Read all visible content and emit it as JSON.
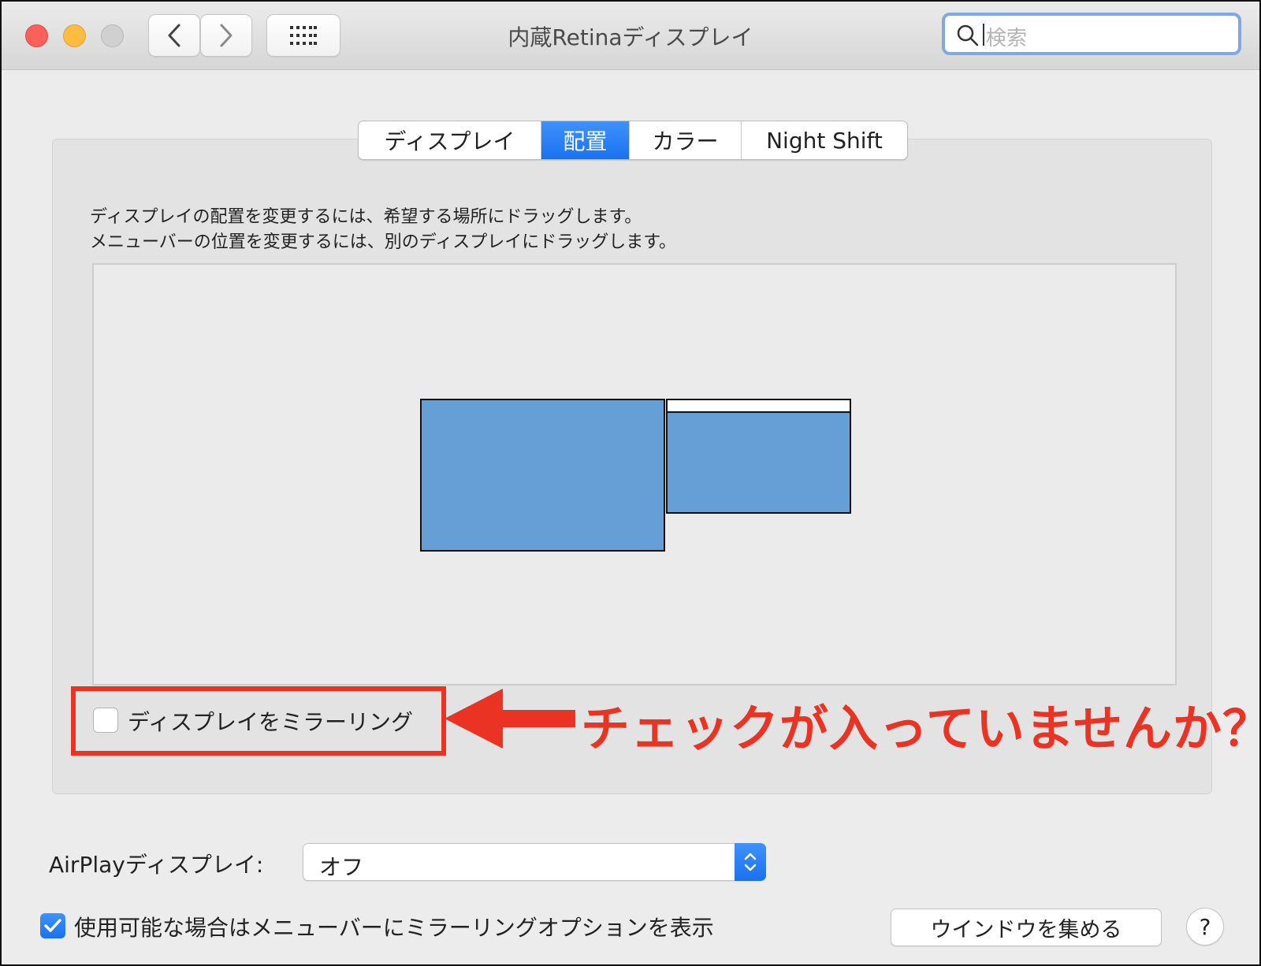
{
  "window": {
    "title": "内蔵Retinaディスプレイ"
  },
  "toolbar": {
    "back_icon": "chevron-left-icon",
    "forward_icon": "chevron-right-icon",
    "grid_icon": "grid-icon"
  },
  "search": {
    "placeholder": "検索"
  },
  "tabs": [
    {
      "label": "ディスプレイ",
      "active": false
    },
    {
      "label": "配置",
      "active": true
    },
    {
      "label": "カラー",
      "active": false
    },
    {
      "label": "Night Shift",
      "active": false
    }
  ],
  "instructions": {
    "line1": "ディスプレイの配置を変更するには、希望する場所にドラッグします。",
    "line2": "メニューバーの位置を変更するには、別のディスプレイにドラッグします。"
  },
  "arrangement": {
    "displays": [
      {
        "name": "display-1",
        "has_menubar": false
      },
      {
        "name": "display-2",
        "has_menubar": true
      }
    ]
  },
  "mirroring": {
    "label": "ディスプレイをミラーリング",
    "checked": false
  },
  "annotation": {
    "text": "チェックが入っていませんか？",
    "color": "#ea3323"
  },
  "airplay": {
    "label": "AirPlayディスプレイ:",
    "value": "オフ"
  },
  "show_mirroring_option": {
    "label": "使用可能な場合はメニューバーにミラーリングオプションを表示",
    "checked": true
  },
  "gather_windows_button": {
    "label": "ウインドウを集める"
  },
  "help_button": {
    "label": "?"
  },
  "colors": {
    "accent": "#1a71f0",
    "display_fill": "#669fd6",
    "highlight": "#ea3323"
  }
}
